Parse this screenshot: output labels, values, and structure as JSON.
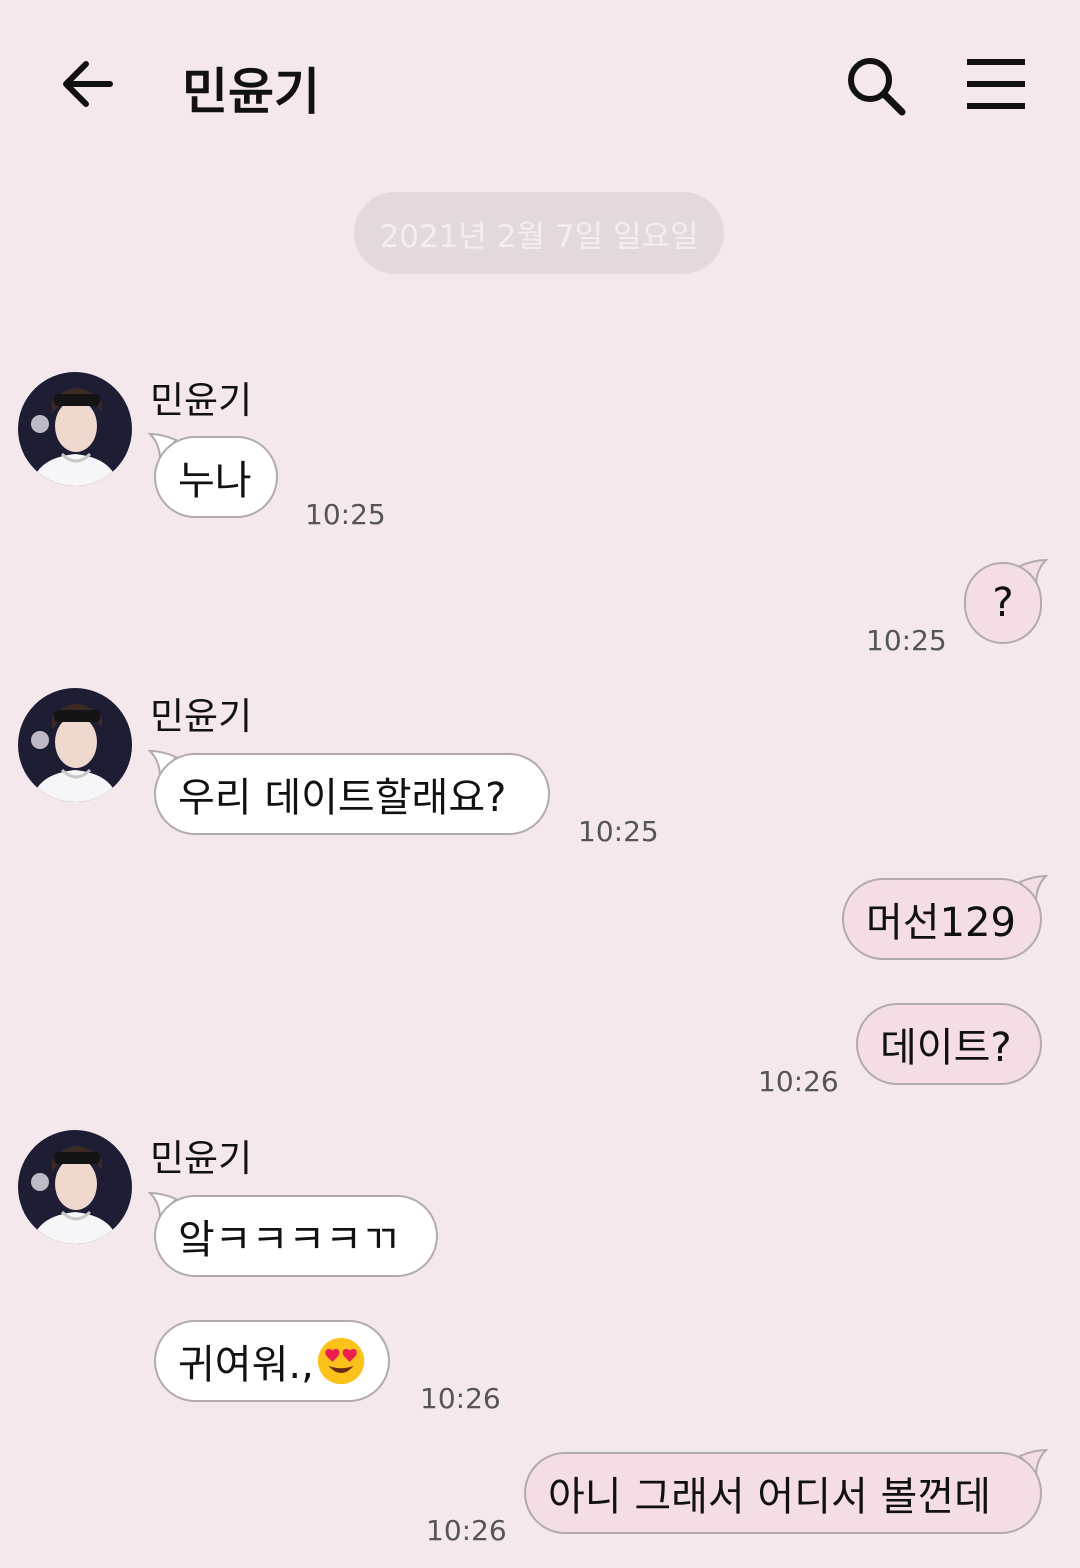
{
  "header": {
    "title": "민윤기",
    "back_icon": "arrow-left-icon",
    "search_icon": "search-icon",
    "menu_icon": "hamburger-menu-icon"
  },
  "date_divider": "2021년 2월 7일 일요일",
  "colors": {
    "background": "#f4e8ed",
    "incoming_bubble": "#ffffff",
    "outgoing_bubble": "#f4dde5",
    "bubble_border": "#b2aaad"
  },
  "messages": [
    {
      "direction": "incoming",
      "sender": "민윤기",
      "text": "누나",
      "time": "10:25"
    },
    {
      "direction": "outgoing",
      "text": "?",
      "time": "10:25"
    },
    {
      "direction": "incoming",
      "sender": "민윤기",
      "text": "우리 데이트할래요?",
      "time": "10:25"
    },
    {
      "direction": "outgoing",
      "text": "머선129"
    },
    {
      "direction": "outgoing",
      "text": "데이트?",
      "time": "10:26"
    },
    {
      "direction": "incoming",
      "sender": "민윤기",
      "text": "앜ㅋㅋㅋㅋㄲ"
    },
    {
      "direction": "incoming",
      "text": "귀여워.,",
      "emoji": "heart-eyes-emoji",
      "time": "10:26"
    },
    {
      "direction": "outgoing",
      "text": "아니 그래서 어디서 볼껀데",
      "time": "10:26"
    }
  ]
}
